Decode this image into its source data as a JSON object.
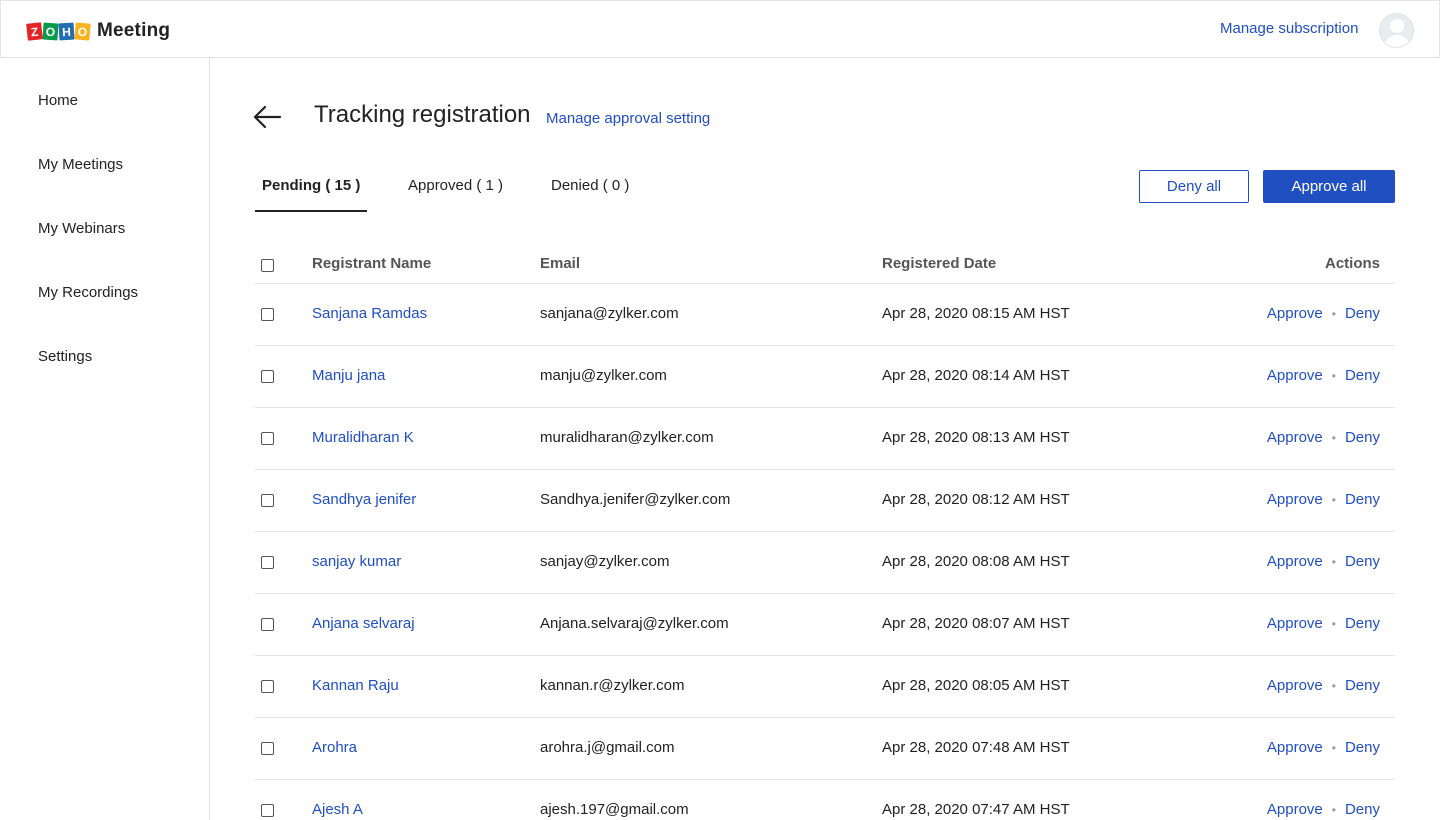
{
  "brand": {
    "letters": [
      "Z",
      "O",
      "H",
      "O"
    ],
    "letter_colors": [
      "#e42527",
      "#089949",
      "#226db4",
      "#f9b21d"
    ],
    "product": "Meeting"
  },
  "header": {
    "manage_subscription": "Manage subscription",
    "avatar_icon": "user-avatar-icon"
  },
  "sidebar": {
    "items": [
      {
        "label": "Home"
      },
      {
        "label": "My Meetings"
      },
      {
        "label": "My Webinars"
      },
      {
        "label": "My Recordings"
      },
      {
        "label": "Settings"
      }
    ]
  },
  "page": {
    "back_icon": "arrow-left-icon",
    "title": "Tracking registration",
    "approval_link": "Manage approval setting"
  },
  "tabs": [
    {
      "label": "Pending ( 15 )",
      "active": true
    },
    {
      "label": "Approved ( 1 )",
      "active": false
    },
    {
      "label": "Denied ( 0 )",
      "active": false
    }
  ],
  "buttons": {
    "deny_all": "Deny all",
    "approve_all": "Approve all"
  },
  "table": {
    "headers": {
      "name": "Registrant Name",
      "email": "Email",
      "date": "Registered Date",
      "actions": "Actions"
    },
    "approve_label": "Approve",
    "deny_label": "Deny",
    "separator": "•",
    "rows": [
      {
        "name": "Sanjana Ramdas",
        "email": "sanjana@zylker.com",
        "date": "Apr 28, 2020 08:15 AM HST"
      },
      {
        "name": "Manju jana",
        "email": "manju@zylker.com",
        "date": "Apr 28, 2020 08:14 AM HST"
      },
      {
        "name": "Muralidharan K",
        "email": "muralidharan@zylker.com",
        "date": "Apr 28, 2020 08:13 AM HST"
      },
      {
        "name": "Sandhya jenifer",
        "email": "Sandhya.jenifer@zylker.com",
        "date": "Apr 28, 2020 08:12 AM HST"
      },
      {
        "name": "sanjay kumar",
        "email": "sanjay@zylker.com",
        "date": "Apr 28, 2020 08:08 AM HST"
      },
      {
        "name": "Anjana selvaraj",
        "email": "Anjana.selvaraj@zylker.com",
        "date": "Apr 28, 2020 08:07 AM HST"
      },
      {
        "name": "Kannan Raju",
        "email": "kannan.r@zylker.com",
        "date": "Apr 28, 2020 08:05 AM HST"
      },
      {
        "name": "Arohra",
        "email": "arohra.j@gmail.com",
        "date": "Apr 28, 2020 07:48 AM HST"
      },
      {
        "name": "Ajesh A",
        "email": "ajesh.197@gmail.com",
        "date": "Apr 28, 2020 07:47 AM HST"
      }
    ]
  },
  "colors": {
    "accent": "#1f4fc1",
    "border": "#e3e3e3"
  }
}
